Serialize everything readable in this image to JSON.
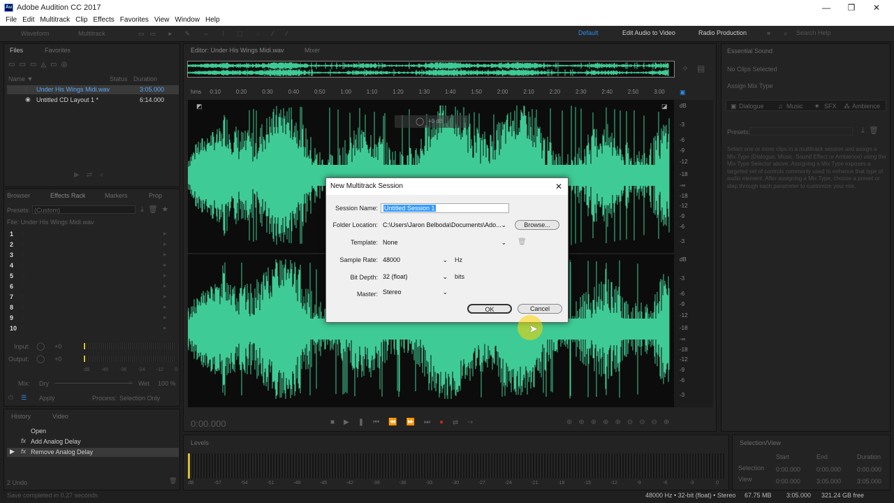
{
  "window": {
    "title": "Adobe Audition CC 2017",
    "logo": "Au"
  },
  "menu": [
    "File",
    "Edit",
    "Multitrack",
    "Clip",
    "Effects",
    "Favorites",
    "View",
    "Window",
    "Help"
  ],
  "toolbar": {
    "waveform": "Waveform",
    "multitrack": "Multitrack"
  },
  "workspaces": [
    "Default",
    "Edit Audio to Video",
    "Radio Production"
  ],
  "search_placeholder": "Search Help",
  "files": {
    "tabs": [
      "Files",
      "Favorites"
    ],
    "col_name": "Name ▼",
    "col_status": "Status",
    "col_duration": "Duration",
    "items": [
      {
        "name": "Under His Wings Midi.wav",
        "duration": "3:05.000"
      },
      {
        "name": "Untitled CD Layout 1 *",
        "duration": "6:14.000"
      }
    ]
  },
  "effects": {
    "tabs": [
      "Browser",
      "Effects Rack",
      "Markers",
      "Prop"
    ],
    "presets_label": "Presets:",
    "presets_value": "(Custom)",
    "file_label": "File: Under His Wings Midi.wav",
    "slots": [
      "1",
      "2",
      "3",
      "4",
      "5",
      "6",
      "7",
      "8",
      "9",
      "10"
    ],
    "input_label": "Input:",
    "input_val": "+0",
    "output_label": "Output:",
    "output_val": "+0",
    "meter_ticks": [
      "dB",
      "-48",
      "-36",
      "-24",
      "-12",
      "0"
    ],
    "mix_label": "Mix:",
    "dry": "Dry",
    "wet": "Wet",
    "wet_pct": "100 %",
    "apply": "Apply",
    "process_label": "Process:",
    "process_value": "Selection Only"
  },
  "history": {
    "tabs": [
      "History",
      "Video"
    ],
    "items": [
      "Open",
      "Add Analog Delay",
      "Remove Analog Delay"
    ],
    "undo": "2 Undo",
    "status": "Save completed in 0.27 seconds"
  },
  "editor": {
    "tab": "Editor: Under His Wings Midi.wav",
    "mixer": "Mixer",
    "ruler": [
      "hms",
      "0:10",
      "0:20",
      "0:30",
      "0:40",
      "0:50",
      "1:00",
      "1:10",
      "1:20",
      "1:30",
      "1:40",
      "1:50",
      "2:00",
      "2:10",
      "2:20",
      "2:30",
      "2:40",
      "2:50",
      "3:00"
    ],
    "db_scale": [
      "dB",
      "-3",
      "-6",
      "-9",
      "-12",
      "-18",
      "-∞",
      "-18",
      "-12",
      "-9",
      "-6",
      "-3"
    ],
    "time": "0:00.000",
    "hud": "+0 dB"
  },
  "dialog": {
    "title": "New Multitrack Session",
    "session_label": "Session Name:",
    "session_value": "Untitled Session 1",
    "folder_label": "Folder Location:",
    "folder_value": "C:\\Users\\Jaron Belboda\\Documents\\Ado...",
    "browse": "Browse...",
    "template_label": "Template:",
    "template_value": "None",
    "rate_label": "Sample Rate:",
    "rate_value": "48000",
    "rate_unit": "Hz",
    "depth_label": "Bit Depth:",
    "depth_value": "32 (float)",
    "depth_unit": "bits",
    "master_label": "Master:",
    "master_value": "Stereo",
    "ok": "OK",
    "cancel": "Cancel"
  },
  "essential": {
    "title": "Essential Sound",
    "no_clips": "No Clips Selected",
    "assign": "Assign Mix Type",
    "types": [
      "Dialogue",
      "Music",
      "SFX",
      "Ambience"
    ],
    "presets": "Presets:",
    "help": "Select one or more clips in a multitrack session and assign a Mix Type (Dialogue, Music, Sound Effect or Ambience) using the Mix Type Selector above. Assigning a Mix Type exposes a targeted set of controls commonly used to enhance that type of audio element. After assigning a Mix Type, choose a preset or step through each parameter to customize your mix."
  },
  "levels": {
    "title": "Levels",
    "ticks": [
      "dB",
      "-57",
      "-54",
      "-51",
      "-48",
      "-45",
      "-42",
      "-39",
      "-36",
      "-33",
      "-30",
      "-27",
      "-24",
      "-21",
      "-18",
      "-15",
      "-12",
      "-9",
      "-6",
      "-3",
      "0"
    ]
  },
  "selview": {
    "title": "Selection/View",
    "cols": [
      "Start",
      "End",
      "Duration"
    ],
    "rows": [
      {
        "label": "Selection",
        "vals": [
          "0:00.000",
          "0:00.000",
          "0:00.000"
        ]
      },
      {
        "label": "View",
        "vals": [
          "0:00.000",
          "3:05.000",
          "3:05.000"
        ]
      }
    ]
  },
  "statusbar": {
    "format": "48000 Hz • 32-bit (float) • Stereo",
    "size": "67.75 MB",
    "duration": "3:05.000",
    "free": "321.24 GB free"
  },
  "colors": {
    "wave": "#3fcb95",
    "accent": "#2d8ceb"
  }
}
